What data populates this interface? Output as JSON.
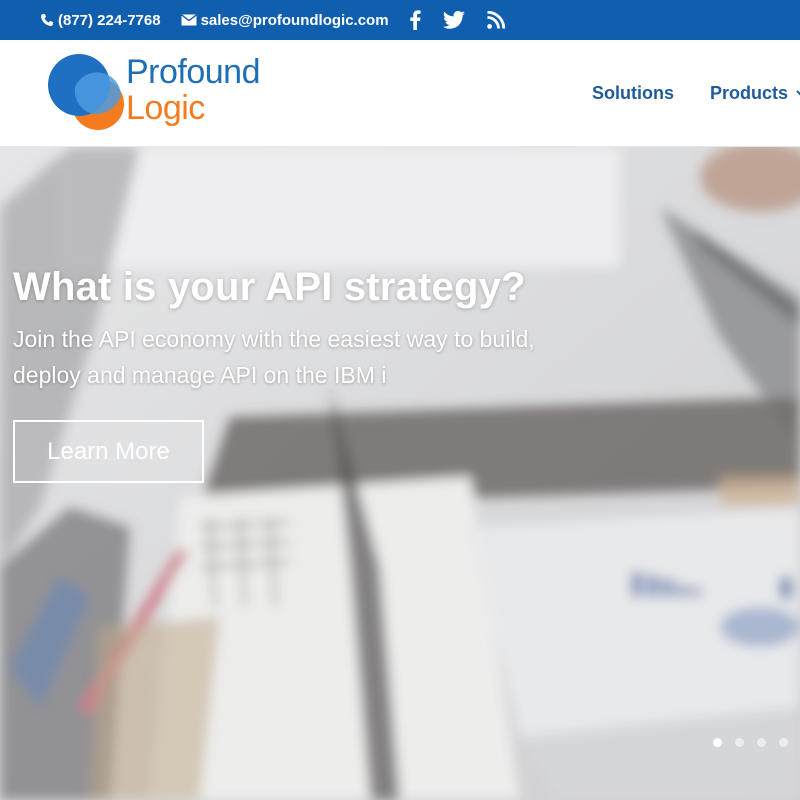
{
  "topbar": {
    "phone": "(877) 224-7768",
    "email": "sales@profoundlogic.com",
    "social": [
      "facebook-icon",
      "twitter-icon",
      "rss-icon"
    ],
    "bg_color": "#0f5fae"
  },
  "header": {
    "logo": {
      "line1": "Profound",
      "line2": "Logic",
      "text_color": "#1f6fb5"
    },
    "nav": [
      {
        "label": "Solutions",
        "has_dropdown": false
      },
      {
        "label": "Products",
        "has_dropdown": true
      }
    ]
  },
  "hero": {
    "title": "What is your API strategy?",
    "subtitle_line1": "Join the API economy with the easiest way to build,",
    "subtitle_line2": "deploy and manage API on the IBM i",
    "button_label": "Learn More",
    "slides_total": 4,
    "active_slide": 1
  }
}
